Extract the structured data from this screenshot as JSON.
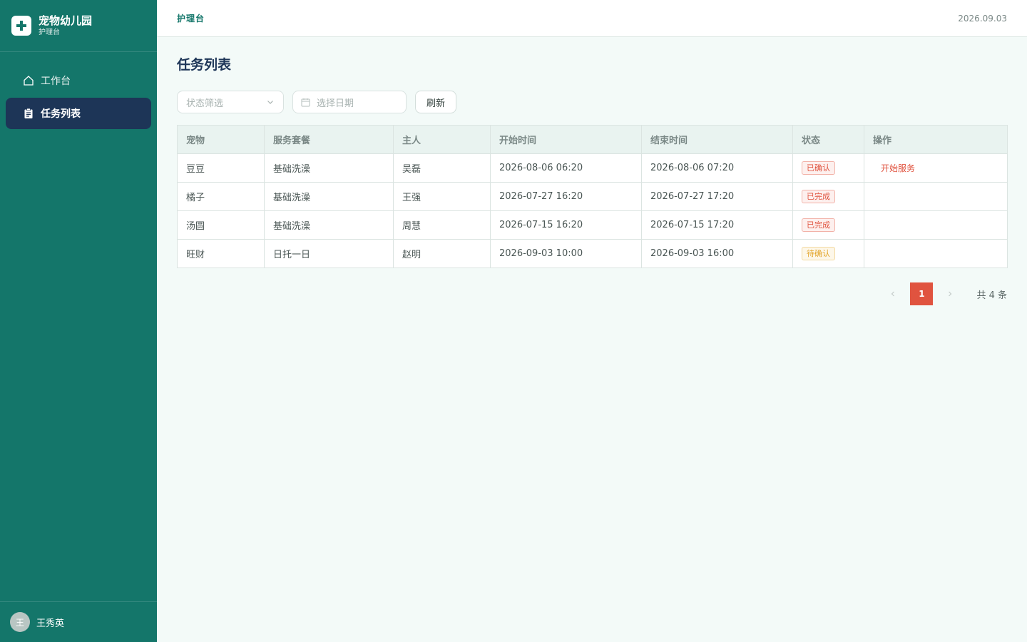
{
  "brand": {
    "title": "宠物幼儿园",
    "subtitle": "护理台"
  },
  "nav": [
    {
      "label": "工作台",
      "icon": "home-icon",
      "active": false
    },
    {
      "label": "任务列表",
      "icon": "clipboard-icon",
      "active": true
    }
  ],
  "user": {
    "avatar": "王",
    "name": "王秀英"
  },
  "header": {
    "breadcrumb": "护理台",
    "date": "2026.09.03"
  },
  "page": {
    "title": "任务列表"
  },
  "filters": {
    "status_placeholder": "状态筛选",
    "date_placeholder": "选择日期",
    "refresh_label": "刷新"
  },
  "table": {
    "headers": [
      "宠物",
      "服务套餐",
      "主人",
      "开始时间",
      "结束时间",
      "状态",
      "操作"
    ],
    "rows": [
      {
        "pet": "豆豆",
        "package": "基础洗澡",
        "owner": "吴磊",
        "start": "2026-08-06 06:20",
        "end": "2026-08-06 07:20",
        "status": "已确认",
        "status_color": "red",
        "action": "开始服务"
      },
      {
        "pet": "橘子",
        "package": "基础洗澡",
        "owner": "王强",
        "start": "2026-07-27 16:20",
        "end": "2026-07-27 17:20",
        "status": "已完成",
        "status_color": "red",
        "action": ""
      },
      {
        "pet": "汤圆",
        "package": "基础洗澡",
        "owner": "周慧",
        "start": "2026-07-15 16:20",
        "end": "2026-07-15 17:20",
        "status": "已完成",
        "status_color": "red",
        "action": ""
      },
      {
        "pet": "旺财",
        "package": "日托一日",
        "owner": "赵明",
        "start": "2026-09-03 10:00",
        "end": "2026-09-03 16:00",
        "status": "待确认",
        "status_color": "yellow",
        "action": ""
      }
    ]
  },
  "pagination": {
    "current": "1",
    "total_text": "共 4 条"
  },
  "colors": {
    "sidebar": "#14766a",
    "active_nav": "#1d3557",
    "accent": "#e0533f",
    "warning": "#e3a52a"
  }
}
